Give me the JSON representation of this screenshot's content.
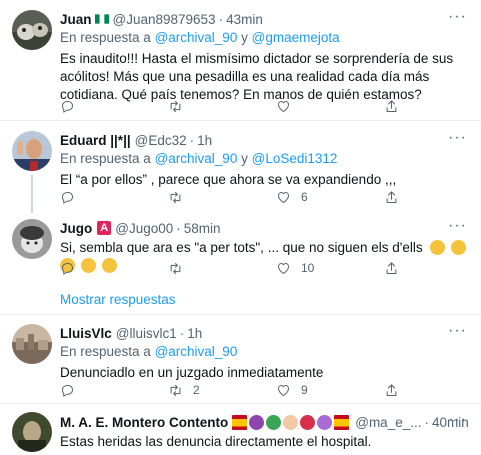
{
  "tweets": [
    {
      "name": "Juan",
      "flag": "nigeria-flag",
      "handle": "@Juan89879653",
      "dot": "·",
      "time": "43min",
      "reply_prefix": "En respuesta a",
      "reply_to_1": "@archival_90",
      "reply_and": "y",
      "reply_to_2": "@gmaemejota",
      "text": "Es inaudito!!! Hasta el mismísimo dictador se sorprendería de sus acólitos! Más que una pesadilla es una realidad cada día más cotidiana. Qué país tenemos? En manos de quién estamos?",
      "reply_count": "",
      "retweet_count": "",
      "like_count": "",
      "more": "···"
    },
    {
      "name": "Eduard ||*||",
      "handle": "@Edc32",
      "dot": "·",
      "time": "1h",
      "reply_prefix": "En respuesta a",
      "reply_to_1": "@archival_90",
      "reply_and": "y",
      "reply_to_2": "@LoSedi1312",
      "text": "El “a por ellos” , parece que ahora se va expandiendo ,,,",
      "reply_count": "",
      "retweet_count": "",
      "like_count": "6",
      "more": "···"
    },
    {
      "name": "Jugo",
      "badge_letter": "A",
      "handle": "@Jugo00",
      "dot": "·",
      "time": "58min",
      "text": "Si, sembla que ara es \"a per tots\", ... que no siguen els d'ells",
      "reply_count": "",
      "retweet_count": "",
      "like_count": "10",
      "more": "···"
    },
    {
      "name": "LluisVlc",
      "handle": "@lluisvlc1",
      "dot": "·",
      "time": "1h",
      "reply_prefix": "En respuesta a",
      "reply_to_1": "@archival_90",
      "text": "Denunciadlo en un juzgado inmediatamente",
      "reply_count": "",
      "retweet_count": "2",
      "like_count": "9",
      "more": "···"
    },
    {
      "name": "M. A. E. Montero Contento",
      "handle": "@ma_e_...",
      "dot": "·",
      "time": "40min",
      "text": "Estas heridas las denuncia directamente el hospital.",
      "more": "···"
    }
  ],
  "show_more_replies": "Mostrar respuestas",
  "colors": {
    "link": "#1d9bf0",
    "secondary": "#536471",
    "separator": "#e6ecf0"
  },
  "icons": [
    "reply-icon",
    "retweet-icon",
    "like-icon",
    "share-icon",
    "more-icon"
  ]
}
